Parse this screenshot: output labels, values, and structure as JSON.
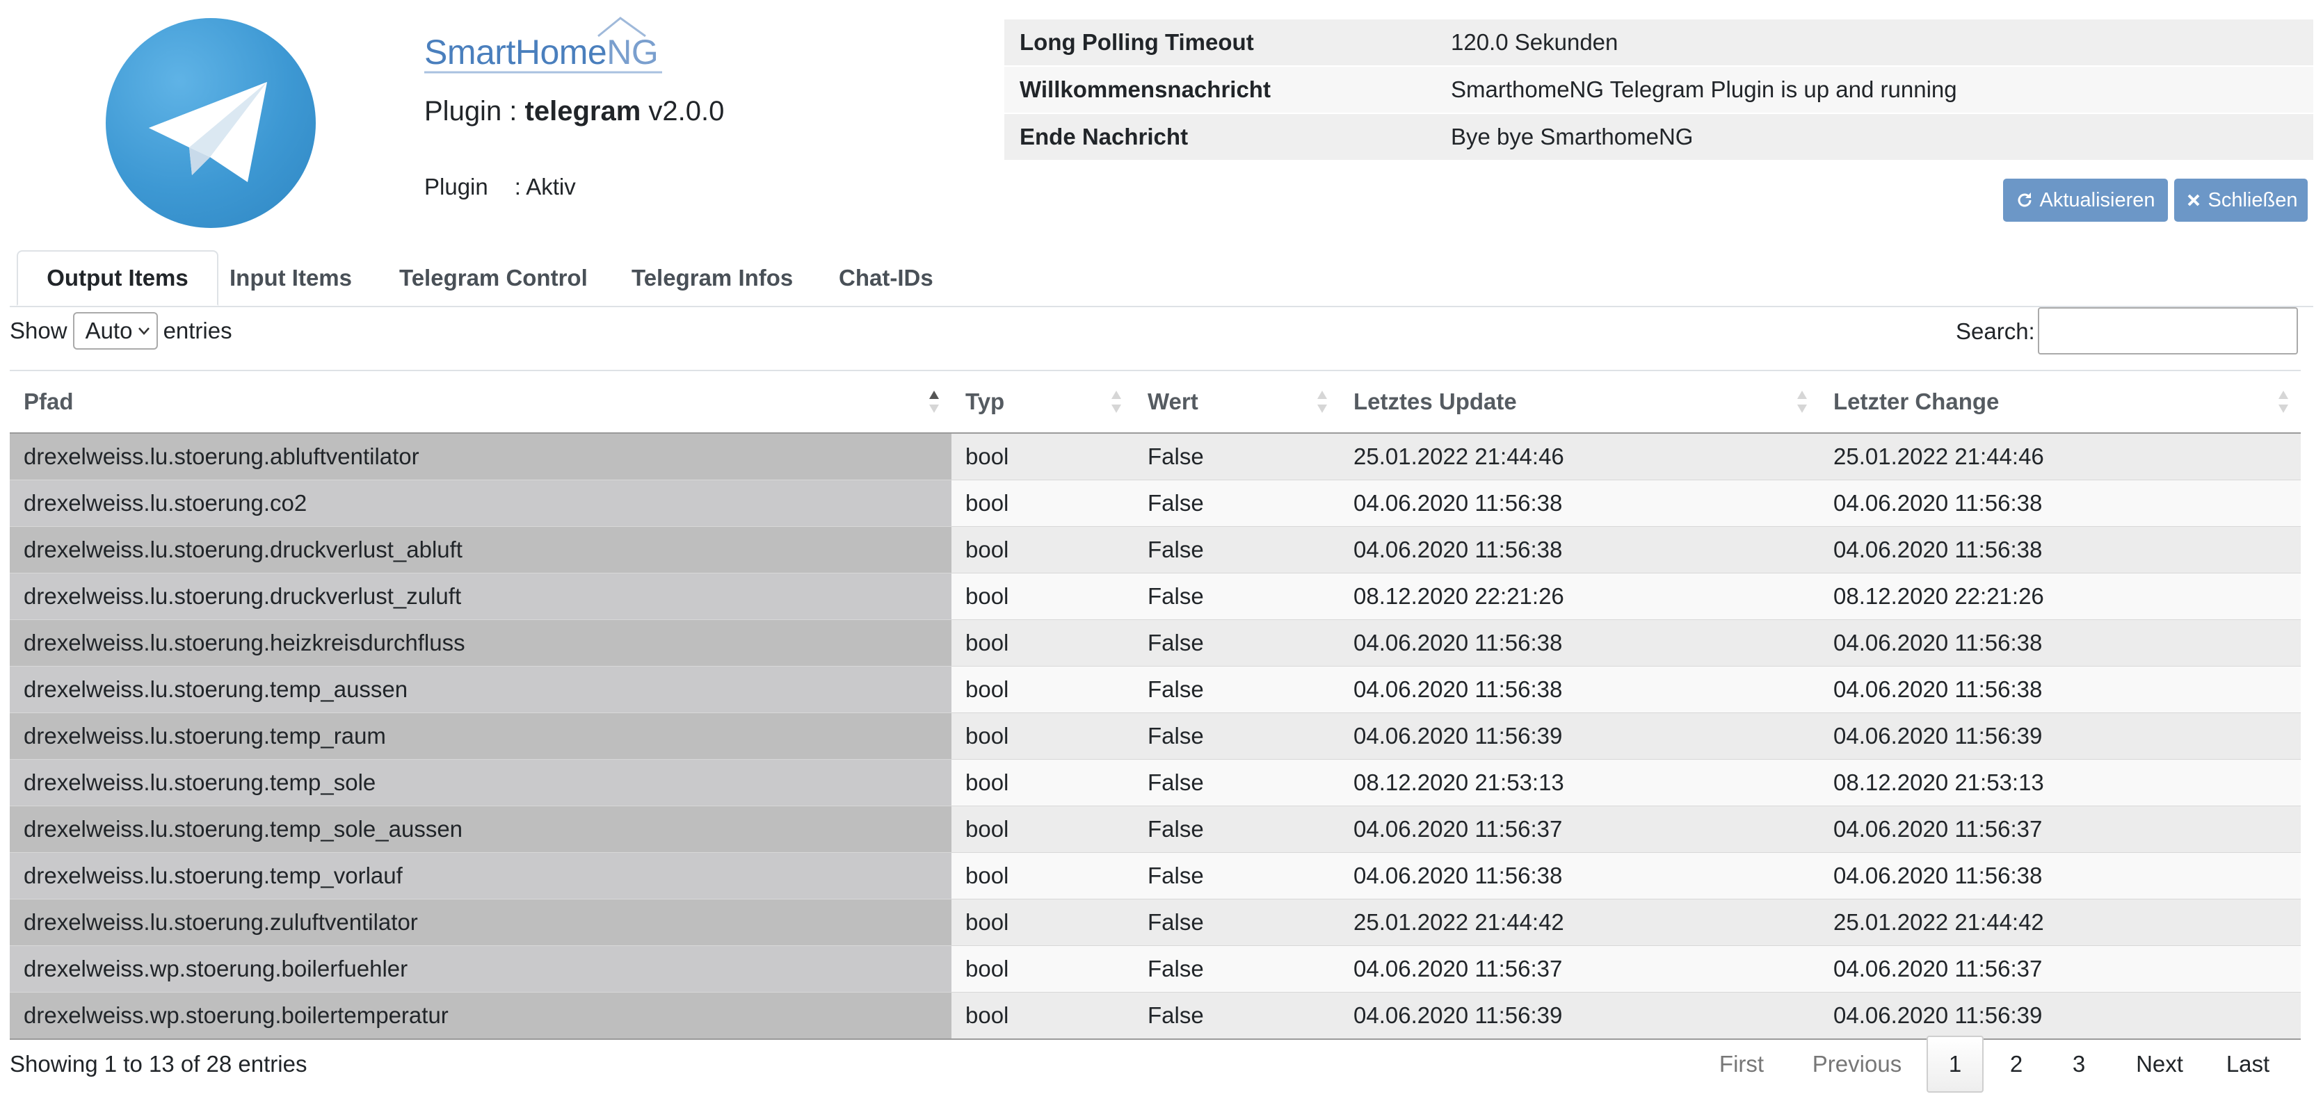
{
  "header": {
    "brand_logo_text_main": "SmartHome",
    "brand_logo_text_ng": "NG",
    "plugin_prefix": "Plugin : ",
    "plugin_name": "telegram",
    "plugin_version": " v2.0.0",
    "status_label": "Plugin",
    "status_value": ": Aktiv"
  },
  "info": [
    {
      "key": "Long Polling Timeout",
      "value": "120.0 Sekunden"
    },
    {
      "key": "Willkommensnachricht",
      "value": "SmarthomeNG Telegram Plugin is up and running"
    },
    {
      "key": "Ende Nachricht",
      "value": "Bye bye SmarthomeNG"
    }
  ],
  "buttons": {
    "refresh_label": "Aktualisieren",
    "close_label": "Schließen"
  },
  "tabs": [
    "Output Items",
    "Input Items",
    "Telegram Control",
    "Telegram Infos",
    "Chat-IDs"
  ],
  "controls": {
    "show_label": "Show",
    "show_value": "Auto",
    "entries_label": "entries",
    "search_label": "Search:",
    "search_value": ""
  },
  "table": {
    "columns": [
      "Pfad",
      "Typ",
      "Wert",
      "Letztes Update",
      "Letzter Change"
    ],
    "rows": [
      [
        "drexelweiss.lu.stoerung.abluftventilator",
        "bool",
        "False",
        "25.01.2022 21:44:46",
        "25.01.2022 21:44:46"
      ],
      [
        "drexelweiss.lu.stoerung.co2",
        "bool",
        "False",
        "04.06.2020 11:56:38",
        "04.06.2020 11:56:38"
      ],
      [
        "drexelweiss.lu.stoerung.druckverlust_abluft",
        "bool",
        "False",
        "04.06.2020 11:56:38",
        "04.06.2020 11:56:38"
      ],
      [
        "drexelweiss.lu.stoerung.druckverlust_zuluft",
        "bool",
        "False",
        "08.12.2020 22:21:26",
        "08.12.2020 22:21:26"
      ],
      [
        "drexelweiss.lu.stoerung.heizkreisdurchfluss",
        "bool",
        "False",
        "04.06.2020 11:56:38",
        "04.06.2020 11:56:38"
      ],
      [
        "drexelweiss.lu.stoerung.temp_aussen",
        "bool",
        "False",
        "04.06.2020 11:56:38",
        "04.06.2020 11:56:38"
      ],
      [
        "drexelweiss.lu.stoerung.temp_raum",
        "bool",
        "False",
        "04.06.2020 11:56:39",
        "04.06.2020 11:56:39"
      ],
      [
        "drexelweiss.lu.stoerung.temp_sole",
        "bool",
        "False",
        "08.12.2020 21:53:13",
        "08.12.2020 21:53:13"
      ],
      [
        "drexelweiss.lu.stoerung.temp_sole_aussen",
        "bool",
        "False",
        "04.06.2020 11:56:37",
        "04.06.2020 11:56:37"
      ],
      [
        "drexelweiss.lu.stoerung.temp_vorlauf",
        "bool",
        "False",
        "04.06.2020 11:56:38",
        "04.06.2020 11:56:38"
      ],
      [
        "drexelweiss.lu.stoerung.zuluftventilator",
        "bool",
        "False",
        "25.01.2022 21:44:42",
        "25.01.2022 21:44:42"
      ],
      [
        "drexelweiss.wp.stoerung.boilerfuehler",
        "bool",
        "False",
        "04.06.2020 11:56:37",
        "04.06.2020 11:56:37"
      ],
      [
        "drexelweiss.wp.stoerung.boilertemperatur",
        "bool",
        "False",
        "04.06.2020 11:56:39",
        "04.06.2020 11:56:39"
      ]
    ]
  },
  "footer": {
    "info_text": "Showing 1 to 13 of 28 entries",
    "pagination": {
      "first": "First",
      "previous": "Previous",
      "pages": [
        "1",
        "2",
        "3"
      ],
      "current": "1",
      "next": "Next",
      "last": "Last"
    }
  },
  "colors": {
    "telegram_blue": "#3d98d3",
    "button_blue": "#6c97c7",
    "brand_blue": "#4a7fbd",
    "pfad_column_gray": "#bebebe"
  }
}
